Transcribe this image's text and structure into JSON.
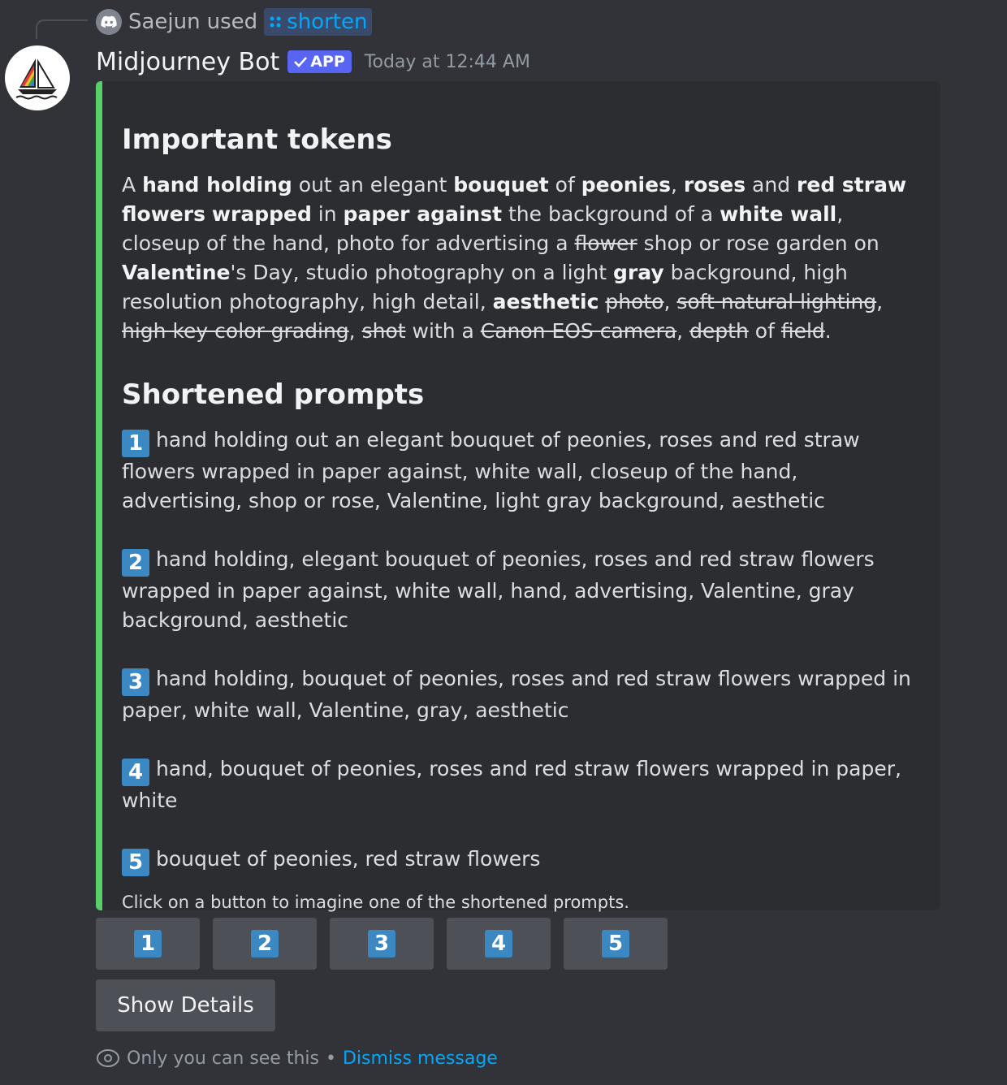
{
  "reply": {
    "user": "Saejun",
    "verb": "used",
    "command": "shorten",
    "command_icon": "slash-command-icon"
  },
  "message": {
    "author": "Midjourney Bot",
    "badge": "APP",
    "timestamp": "Today at 12:44 AM"
  },
  "embed": {
    "accent_color": "#57d167",
    "tokens_heading": "Important tokens",
    "tokens_text": [
      {
        "t": "A ",
        "s": "n"
      },
      {
        "t": "hand holding",
        "s": "b"
      },
      {
        "t": " out an elegant ",
        "s": "n"
      },
      {
        "t": "bouquet",
        "s": "b"
      },
      {
        "t": " of ",
        "s": "n"
      },
      {
        "t": "peonies",
        "s": "b"
      },
      {
        "t": ", ",
        "s": "n"
      },
      {
        "t": "roses",
        "s": "b"
      },
      {
        "t": " and ",
        "s": "n"
      },
      {
        "t": "red straw flowers",
        "s": "b"
      },
      {
        "t": " ",
        "s": "n"
      },
      {
        "t": "wrapped",
        "s": "b"
      },
      {
        "t": " in ",
        "s": "n"
      },
      {
        "t": "paper against",
        "s": "b"
      },
      {
        "t": " the background of a ",
        "s": "n"
      },
      {
        "t": "white wall",
        "s": "b"
      },
      {
        "t": ", closeup of the hand, photo for advertising a ",
        "s": "n"
      },
      {
        "t": "flower",
        "s": "x"
      },
      {
        "t": " shop or rose garden on ",
        "s": "n"
      },
      {
        "t": "Valentine",
        "s": "b"
      },
      {
        "t": "'s Day, studio photography on a light ",
        "s": "n"
      },
      {
        "t": "gray",
        "s": "b"
      },
      {
        "t": " background, high resolution photography, high detail, ",
        "s": "n"
      },
      {
        "t": "aesthetic",
        "s": "b"
      },
      {
        "t": " ",
        "s": "n"
      },
      {
        "t": "photo",
        "s": "x"
      },
      {
        "t": ", ",
        "s": "n"
      },
      {
        "t": "soft natural lighting",
        "s": "x"
      },
      {
        "t": ", ",
        "s": "n"
      },
      {
        "t": "high key color grading",
        "s": "x"
      },
      {
        "t": ", ",
        "s": "n"
      },
      {
        "t": "shot",
        "s": "x"
      },
      {
        "t": " with a ",
        "s": "n"
      },
      {
        "t": "Canon EOS camera",
        "s": "x"
      },
      {
        "t": ", ",
        "s": "n"
      },
      {
        "t": "depth",
        "s": "x"
      },
      {
        "t": " of ",
        "s": "n"
      },
      {
        "t": "field",
        "s": "x"
      },
      {
        "t": ".",
        "s": "n"
      }
    ],
    "prompts_heading": "Shortened prompts",
    "prompts": [
      {
        "num": "1",
        "text": "hand holding out an elegant bouquet of peonies, roses and red straw flowers wrapped in paper against, white wall, closeup of the hand, advertising, shop or rose, Valentine, light gray background, aesthetic"
      },
      {
        "num": "2",
        "text": "hand holding, elegant bouquet of peonies, roses and red straw flowers wrapped in paper against, white wall, hand, advertising, Valentine, gray background, aesthetic"
      },
      {
        "num": "3",
        "text": "hand holding, bouquet of peonies, roses and red straw flowers wrapped in paper, white wall, Valentine, gray, aesthetic"
      },
      {
        "num": "4",
        "text": "hand, bouquet of peonies, roses and red straw flowers wrapped in paper, white"
      },
      {
        "num": "5",
        "text": "bouquet of peonies, red straw flowers"
      }
    ],
    "footer": "Click on a button to imagine one of the shortened prompts."
  },
  "buttons": [
    "1",
    "2",
    "3",
    "4",
    "5"
  ],
  "show_details": "Show Details",
  "ephemeral": {
    "text": "Only you can see this",
    "separator": "•",
    "dismiss": "Dismiss message"
  }
}
